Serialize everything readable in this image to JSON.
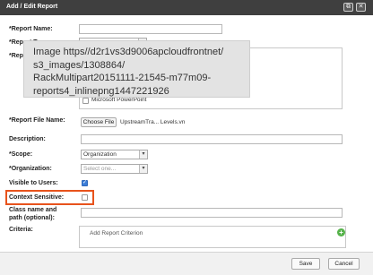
{
  "window": {
    "title": "Add / Edit Report",
    "restore_icon": "⧉",
    "close_icon": "✕"
  },
  "form": {
    "report_name_label": "*Report Name:",
    "report_type_label": "*Report Type:",
    "report_types_label": "*Rep",
    "report_type_selected": "",
    "report_file_label": "*Report File Name:",
    "choose_file_label": "Choose File",
    "file_name": "UpstreamTra... Levels.vn",
    "description_label": "Description:",
    "scope_label": "*Scope:",
    "scope_value": "Organization",
    "organization_label": "*Organization:",
    "organization_placeholder": "Select one...",
    "visible_label": "Visible to Users:",
    "visible_checked": true,
    "context_label": "Context Sensitive:",
    "context_checked": false,
    "class_name_label": "Class name and path (optional):",
    "criteria_label": "Criteria:",
    "add_criterion_label": "Add Report Criterion"
  },
  "types": [
    {
      "label": "Microsoft PowerPoint",
      "checked": false
    }
  ],
  "tooltip": {
    "line1": "Image https//d2r1vs3d9006apcloudfrontnet/",
    "line2": "s3_images/1308864/",
    "line3": "RackMultipart20151111-21545-m77m09-",
    "line4": "reports4_inlinepng1447221926"
  },
  "footer": {
    "save_label": "Save",
    "cancel_label": "Cancel"
  },
  "colors": {
    "titlebar": "#3f3f3f",
    "highlight": "#e8531c",
    "checkbox_checked": "#3b7dd8",
    "add_icon": "#55b24a"
  }
}
